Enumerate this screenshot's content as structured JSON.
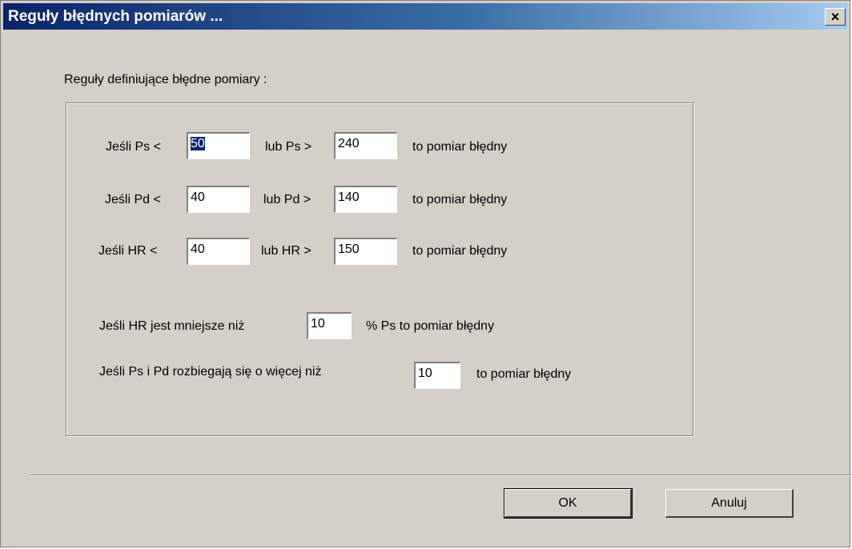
{
  "window": {
    "title": "Reguły błędnych pomiarów ...",
    "close_label": "×"
  },
  "dialog": {
    "heading": "Reguły definiujące błędne pomiary :",
    "rules": [
      {
        "prefix": "Jeśli Ps <",
        "min": "50",
        "mid": "lub Ps >",
        "max": "240",
        "suffix": "to pomiar błędny"
      },
      {
        "prefix": "Jeśli Pd <",
        "min": "40",
        "mid": "lub Pd >",
        "max": "140",
        "suffix": "to pomiar błędny"
      },
      {
        "prefix": "Jeśli HR <",
        "min": "40",
        "mid": "lub HR >",
        "max": "150",
        "suffix": "to pomiar błędny"
      }
    ],
    "hr_rule": {
      "prefix": "Jeśli HR jest mniejsze niż",
      "value": "10",
      "suffix": "% Ps to pomiar błędny"
    },
    "diff_rule": {
      "prefix": "Jeśli Ps i Pd rozbiegają się o więcej niż",
      "value": "10",
      "suffix": "to pomiar błędny"
    }
  },
  "buttons": {
    "ok": "OK",
    "cancel": "Anuluj"
  }
}
